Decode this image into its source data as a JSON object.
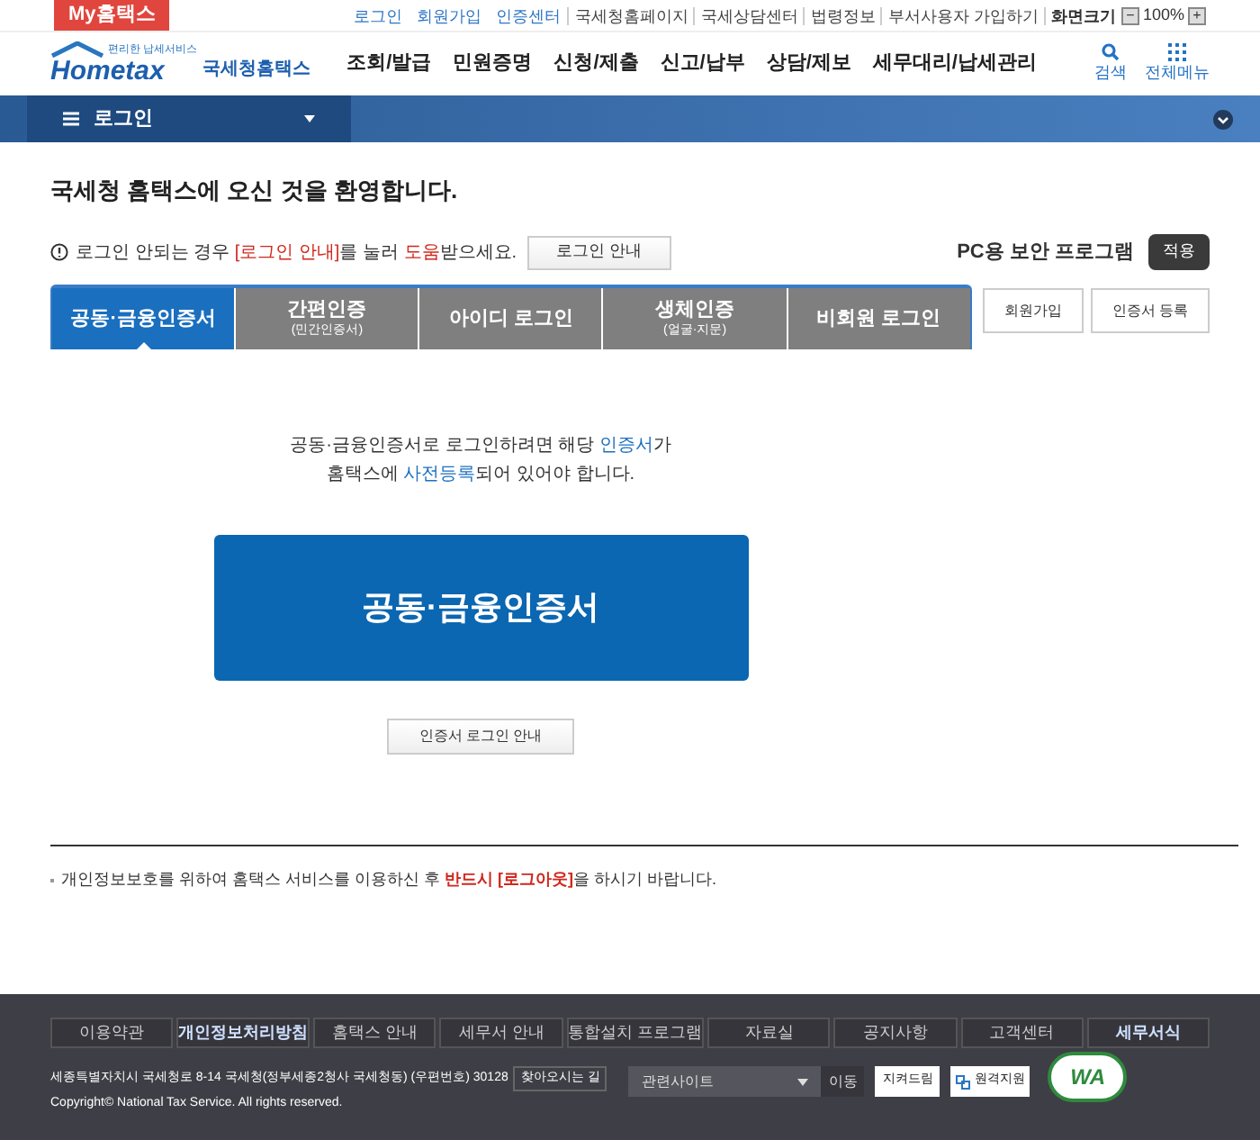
{
  "top_bar": {
    "my_link": "My홈택스",
    "links": [
      {
        "label": "로그인",
        "kind": "blue"
      },
      {
        "label": "회원가입",
        "kind": "blue"
      },
      {
        "label": "인증센터",
        "kind": "blue"
      },
      {
        "label": "국세청홈페이지",
        "kind": "plain"
      },
      {
        "label": "국세상담센터",
        "kind": "plain"
      },
      {
        "label": "법령정보",
        "kind": "plain"
      },
      {
        "label": "부서사용자 가입하기",
        "kind": "plain"
      }
    ],
    "zoom_label": "화면크기",
    "zoom_minus": "−",
    "zoom_value": "100%",
    "zoom_plus": "+"
  },
  "header": {
    "logo_small": "편리한 납세서비스",
    "logo_word": "Hometax",
    "logo_name": "국세청홈택스",
    "menu": [
      "조회/발급",
      "민원증명",
      "신청/제출",
      "신고/납부",
      "상담/제보",
      "세무대리/납세관리"
    ],
    "search": "검색",
    "all_menu": "전체메뉴"
  },
  "location_bar": {
    "label": "로그인"
  },
  "welcome": "국세청 홈택스에 오신 것을 환영합니다.",
  "notice": "로그인 안되는 경우 **[로그인 안내]**를 눌러 **도움**받으세요.",
  "notice_button": "로그인 안내",
  "security_label": "PC용 보안 프로그램",
  "security_button": "적용",
  "tabs": [
    {
      "label": "공동·금융인증서",
      "selected": true
    },
    {
      "label": "간편인증",
      "sub": "(민간인증서)",
      "selected": false
    },
    {
      "label": "아이디 로그인",
      "selected": false
    },
    {
      "label": "생체인증",
      "sub": "(얼굴·지문)",
      "selected": false
    },
    {
      "label": "비회원 로그인",
      "selected": false
    }
  ],
  "side_buttons": [
    "회원가입",
    "인증서 등록"
  ],
  "panel": {
    "line_1": "공동·금융인증서로 로그인하려면 해당 **인증서**가",
    "line_2": "홈택스에 **사전등록**되어 있어야 합니다.",
    "main_button": "공동·금융인증서",
    "guide_button": "인증서 로그인 안내"
  },
  "privacy_note": "개인정보보호를 위하여 홈택스 서비스를 이용하신 후 **반드시 [로그아웃]**을 하시기 바랍니다.",
  "footer": {
    "links": [
      {
        "label": "이용약관",
        "bold": false
      },
      {
        "label": "개인정보처리방침",
        "bold": true
      },
      {
        "label": "홈택스 안내",
        "bold": false
      },
      {
        "label": "세무서 안내",
        "bold": false
      },
      {
        "label": "통합설치 프로그램",
        "bold": false
      },
      {
        "label": "자료실",
        "bold": false
      },
      {
        "label": "공지사항",
        "bold": false
      },
      {
        "label": "고객센터",
        "bold": false
      },
      {
        "label": "세무서식",
        "bold": true
      }
    ],
    "address": "세종특별자치시 국세청로 8-14 국세청(정부세종2청사 국세청동) (우편번호) 30128",
    "directions": "찾아오시는 길",
    "copyright": "Copyright© National Tax Service. All rights reserved.",
    "related_sites": "관련사이트",
    "go": "이동",
    "button_1": "지켜드림",
    "button_2": "원격지원",
    "badge": "WA"
  }
}
